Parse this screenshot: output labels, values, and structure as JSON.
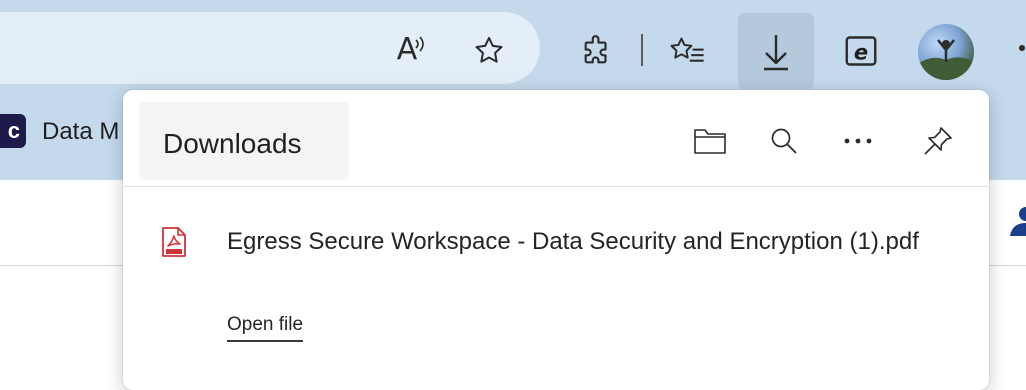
{
  "browser": {
    "read_aloud_letter": "A",
    "favorites_bar": {
      "badge": "c",
      "item_label": "Data M"
    }
  },
  "downloads_panel": {
    "title": "Downloads",
    "items": [
      {
        "file_name": "Egress Secure Workspace - Data Security and Encryption (1).pdf",
        "action_label": "Open file",
        "file_type_icon": "pdf-icon"
      }
    ]
  },
  "colors": {
    "toolbar_bg": "#c5d9ed",
    "active_button_bg": "#b5c9dc",
    "pdf_red": "#d13438"
  }
}
